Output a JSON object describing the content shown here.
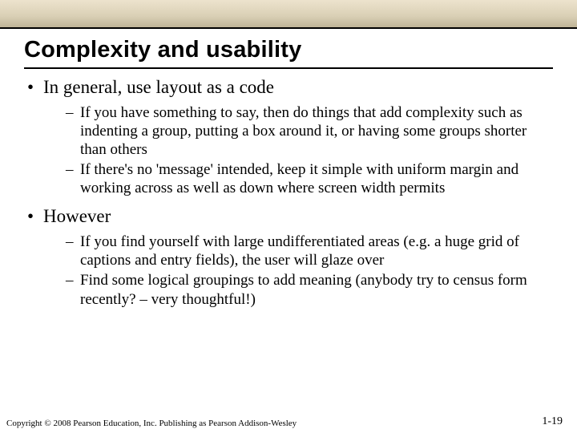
{
  "title": "Complexity and usability",
  "bullets": [
    {
      "text": "In general, use layout as a code",
      "sub": [
        "If you have something to say, then do things that add complexity such as indenting a group, putting a box around it, or having some groups shorter than others",
        "If there's no 'message' intended, keep it simple with uniform margin and working across as well as down where screen width permits"
      ]
    },
    {
      "text": "However",
      "sub": [
        "If you find yourself with large undifferentiated areas (e.g. a huge grid of captions and entry fields), the user will glaze over",
        "Find some logical groupings to add meaning (anybody try to census form recently? – very thoughtful!)"
      ]
    }
  ],
  "footer": {
    "copyright": "Copyright © 2008 Pearson Education, Inc. Publishing as Pearson Addison-Wesley",
    "page": "1-19"
  }
}
